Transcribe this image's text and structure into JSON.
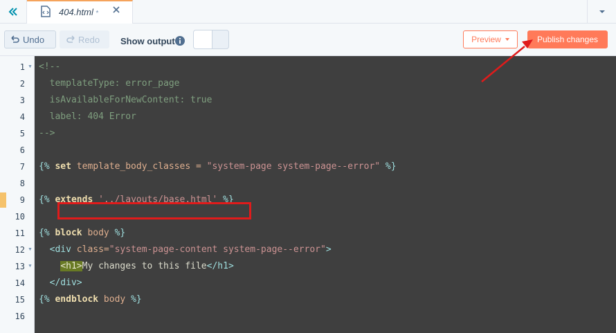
{
  "tab": {
    "file_name": "404.html",
    "modified_marker": "*"
  },
  "toolbar": {
    "undo_label": "Undo",
    "redo_label": "Redo",
    "show_output_label": "Show output",
    "preview_label": "Preview",
    "publish_label": "Publish changes"
  },
  "colors": {
    "accent": "#ff7a59",
    "highlight_box": "#e01b1b",
    "modified_line_marker": "#f5c26b"
  },
  "editor": {
    "modified_lines": [
      9
    ],
    "foldable_lines": [
      1,
      12,
      13
    ],
    "lines": [
      [
        {
          "t": "c",
          "v": "<!--"
        }
      ],
      [
        {
          "t": "c",
          "v": "  templateType: error_page"
        }
      ],
      [
        {
          "t": "c",
          "v": "  isAvailableForNewContent: true"
        }
      ],
      [
        {
          "t": "c",
          "v": "  label: 404 Error"
        }
      ],
      [
        {
          "t": "c",
          "v": "-->"
        }
      ],
      [],
      [
        {
          "t": "p",
          "v": "{% "
        },
        {
          "t": "k",
          "v": "set"
        },
        {
          "t": "t",
          "v": " template_body_classes = "
        },
        {
          "t": "s",
          "v": "\"system-page system-page--error\""
        },
        {
          "t": "p",
          "v": " %}"
        }
      ],
      [],
      [
        {
          "t": "p",
          "v": "{% "
        },
        {
          "t": "k",
          "v": "extends"
        },
        {
          "t": "t",
          "v": " "
        },
        {
          "t": "s",
          "v": "'../layouts/base.html'"
        },
        {
          "t": "p",
          "v": " %}"
        }
      ],
      [],
      [
        {
          "t": "p",
          "v": "{% "
        },
        {
          "t": "k",
          "v": "block"
        },
        {
          "t": "t",
          "v": " body "
        },
        {
          "t": "p",
          "v": "%}"
        }
      ],
      [
        {
          "t": "p",
          "v": "  <div "
        },
        {
          "t": "t",
          "v": "class="
        },
        {
          "t": "s",
          "v": "\"system-page-content system-page--error\""
        },
        {
          "t": "p",
          "v": ">"
        }
      ],
      [
        {
          "t": "",
          "v": "    "
        },
        {
          "t": "hl",
          "v": "<h1>"
        },
        {
          "t": "x",
          "v": "My changes to this file"
        },
        {
          "t": "p",
          "v": "</h1>"
        }
      ],
      [
        {
          "t": "p",
          "v": "  </div>"
        }
      ],
      [
        {
          "t": "p",
          "v": "{% "
        },
        {
          "t": "k",
          "v": "endblock"
        },
        {
          "t": "t",
          "v": " body "
        },
        {
          "t": "p",
          "v": "%}"
        }
      ],
      []
    ]
  }
}
